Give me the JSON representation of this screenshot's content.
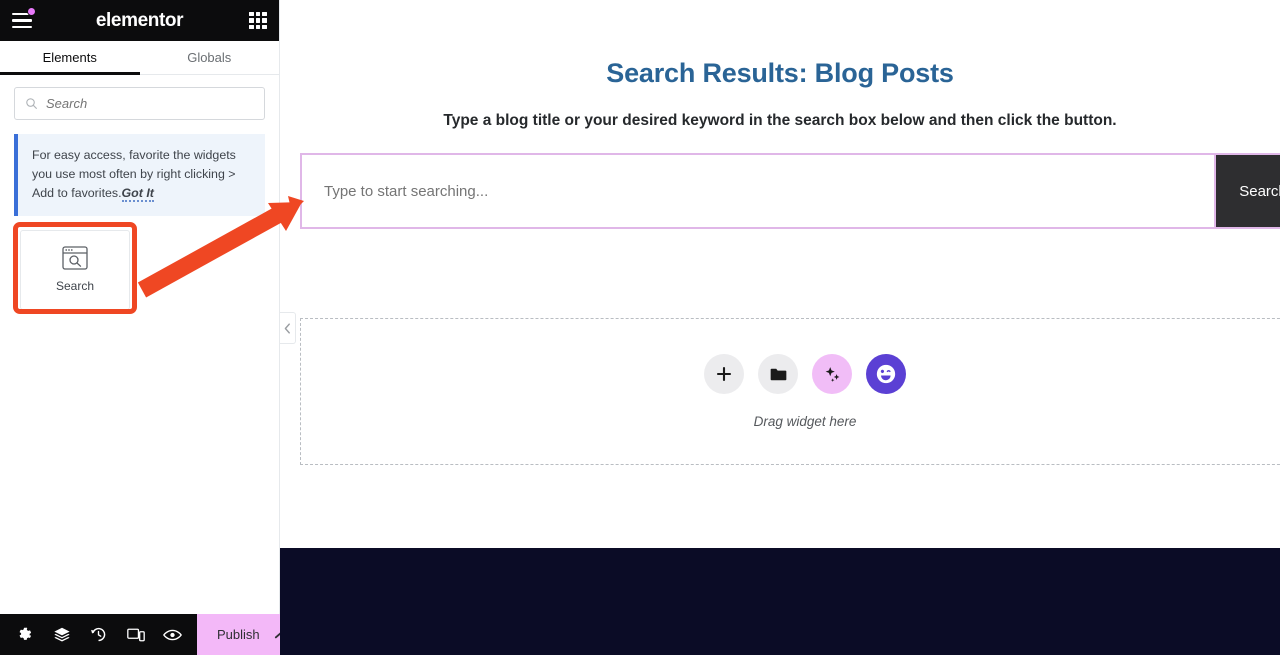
{
  "panel": {
    "brand": "elementor",
    "menu_icon": "hamburger-icon",
    "notification_icon": "notification-dot",
    "apps_icon": "apps-grid-icon",
    "tabs": [
      {
        "label": "Elements",
        "active": true
      },
      {
        "label": "Globals",
        "active": false
      }
    ],
    "search": {
      "placeholder": "Search",
      "value": "",
      "icon": "search-icon"
    },
    "notice": {
      "text": "For easy access, favorite the widgets you use most often by right clicking > Add to favorites.",
      "action_label": "Got It"
    },
    "widgets": [
      {
        "label": "Search",
        "icon": "browser-search-icon",
        "highlighted": true
      }
    ],
    "footer": {
      "icons": [
        {
          "name": "settings-gear-icon",
          "glyph": "gear"
        },
        {
          "name": "navigator-layers-icon",
          "glyph": "layers"
        },
        {
          "name": "history-icon",
          "glyph": "history"
        },
        {
          "name": "responsive-mode-icon",
          "glyph": "responsive"
        },
        {
          "name": "preview-eye-icon",
          "glyph": "eye"
        }
      ],
      "publish_label": "Publish",
      "publish_chevron": "chevron-up-icon"
    },
    "collapse_icon": "chevron-left-icon"
  },
  "canvas": {
    "title": "Search Results: Blog Posts",
    "subtitle": "Type a blog title or your desired keyword in the search box below and then click the button.",
    "search": {
      "placeholder": "Type to start searching...",
      "value": "",
      "button_label": "Search"
    },
    "dropzone": {
      "label": "Drag widget here",
      "buttons": [
        {
          "name": "add-element-button",
          "icon": "plus-icon"
        },
        {
          "name": "add-template-button",
          "icon": "folder-icon"
        },
        {
          "name": "ai-button",
          "icon": "sparkle-icon"
        },
        {
          "name": "assistant-button",
          "icon": "wink-face-icon"
        }
      ]
    }
  },
  "annotation": {
    "arrow": "orange-arrow-pointing-to-search-field",
    "highlight": "orange-rectangle-around-search-widget"
  },
  "colors": {
    "panel_header_bg": "#0c0c0d",
    "accent_publish": "#f3b8f8",
    "notice_accent": "#3a6fd8",
    "title_blue": "#2a6496",
    "search_border": "#e0b7e8",
    "search_button_bg": "#2e2e30",
    "annotation_orange": "#ef4723",
    "footer_strip": "#0b0c26",
    "ai_pink": "#f1bdf7",
    "assistant_purple": "#5b40d4"
  }
}
